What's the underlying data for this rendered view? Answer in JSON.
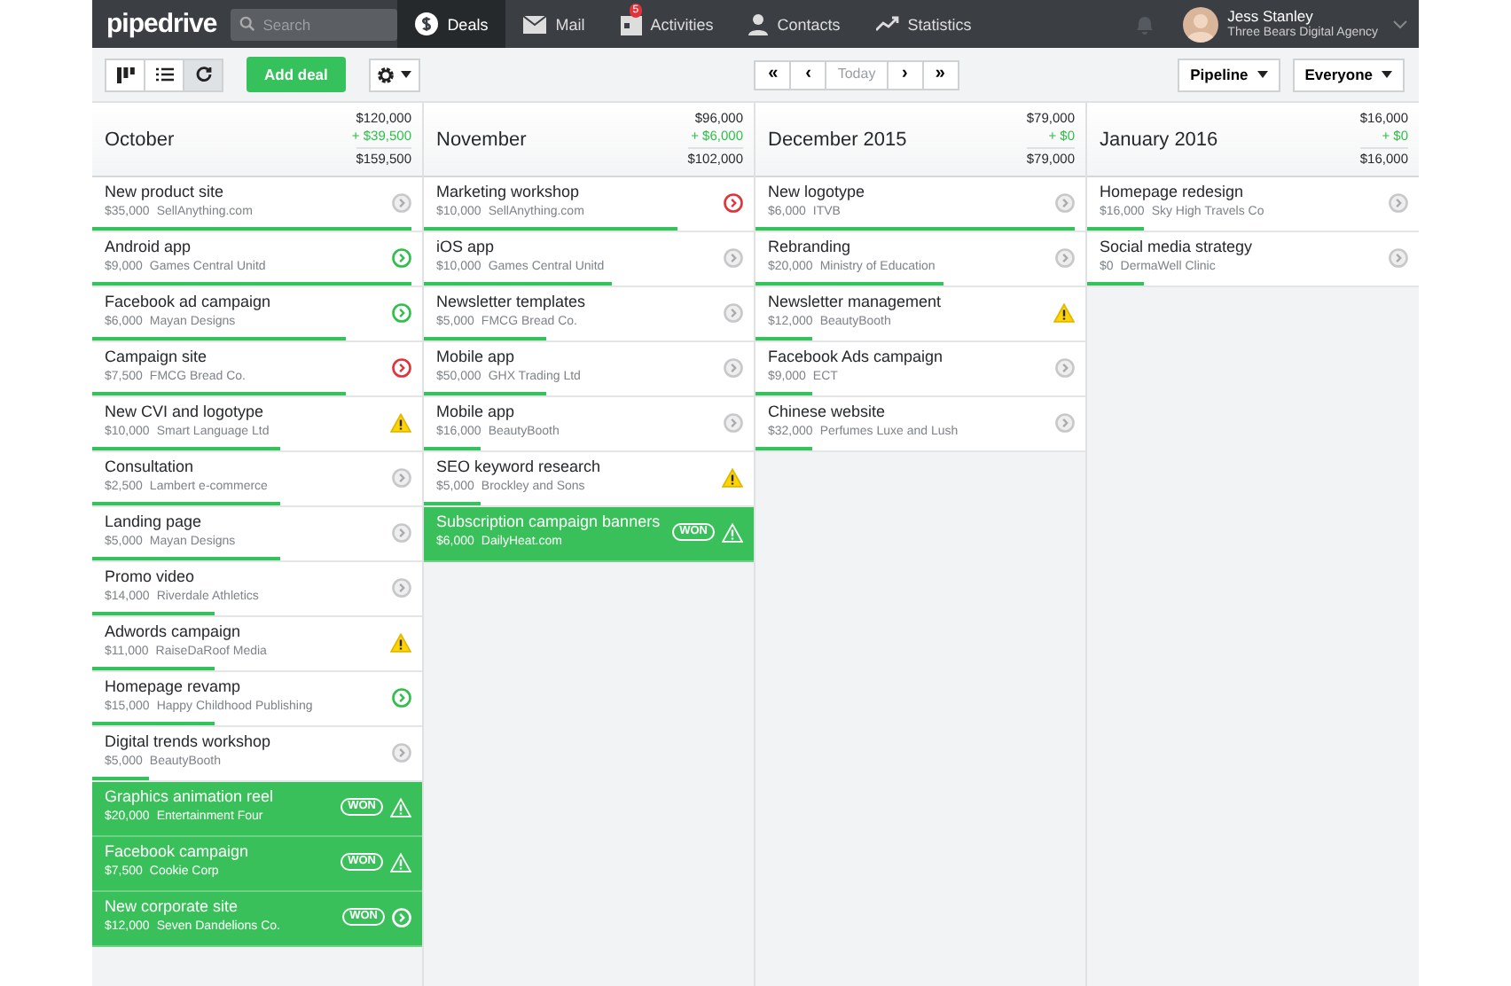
{
  "nav": {
    "logo": "pipedrive",
    "search": {
      "placeholder": "Search"
    },
    "items": [
      {
        "label": "Deals",
        "selected": true
      },
      {
        "label": "Mail",
        "selected": false
      },
      {
        "label": "Activities",
        "selected": false,
        "badge": "5"
      },
      {
        "label": "Contacts",
        "selected": false
      },
      {
        "label": "Statistics",
        "selected": false
      }
    ],
    "user": {
      "name": "Jess Stanley",
      "company": "Three Bears Digital Agency"
    }
  },
  "toolbar": {
    "views": [
      {
        "selected": false
      },
      {
        "selected": false
      },
      {
        "selected": true
      }
    ],
    "add_button": "Add deal",
    "period_nav": [
      "«",
      "‹",
      "Today",
      "›",
      "»"
    ],
    "filters": [
      "Pipeline",
      "Everyone"
    ]
  },
  "columns": [
    {
      "title": "October",
      "total": "$120,000",
      "won": "+ $39,500",
      "sum": "$159,500",
      "deals": [
        {
          "title": "New product site",
          "value": "$35,000",
          "org": "SellAnything.com",
          "kind": "none",
          "level": 0.97,
          "won": false
        },
        {
          "title": "Android app",
          "value": "$9,000",
          "org": "Games Central Unitd",
          "kind": "planned",
          "level": 0.97,
          "won": false
        },
        {
          "title": "Facebook ad campaign",
          "value": "$6,000",
          "org": "Mayan Designs",
          "kind": "planned",
          "level": 0.77,
          "won": false
        },
        {
          "title": "Campaign site",
          "value": "$7,500",
          "org": "FMCG Bread Co.",
          "kind": "overdue",
          "level": 0.77,
          "won": false
        },
        {
          "title": "New CVI and logotype",
          "value": "$10,000",
          "org": "Smart Language Ltd",
          "kind": "warning",
          "level": 0.57,
          "won": false
        },
        {
          "title": "Consultation",
          "value": "$2,500",
          "org": "Lambert e-commerce",
          "kind": "none",
          "level": 0.57,
          "won": false
        },
        {
          "title": "Landing page",
          "value": "$5,000",
          "org": "Mayan Designs",
          "kind": "none",
          "level": 0.57,
          "won": false
        },
        {
          "title": "Promo video",
          "value": "$14,000",
          "org": "Riverdale Athletics",
          "kind": "none",
          "level": 0.37,
          "won": false
        },
        {
          "title": "Adwords campaign",
          "value": "$11,000",
          "org": "RaiseDaRoof Media",
          "kind": "warning",
          "level": 0.37,
          "won": false
        },
        {
          "title": "Homepage revamp",
          "value": "$15,000",
          "org": "Happy Childhood Publishing",
          "kind": "planned",
          "level": 0.37,
          "won": false
        },
        {
          "title": "Digital trends workshop",
          "value": "$5,000",
          "org": "BeautyBooth",
          "kind": "none",
          "level": 0.17,
          "won": false
        },
        {
          "title": "Graphics animation reel",
          "value": "$20,000",
          "org": "Entertainment Four",
          "kind": "warning",
          "won": true,
          "badge": "WON"
        },
        {
          "title": "Facebook campaign",
          "value": "$7,500",
          "org": "Cookie Corp",
          "kind": "warning",
          "won": true,
          "badge": "WON"
        },
        {
          "title": "New corporate site",
          "value": "$12,000",
          "org": "Seven Dandelions Co.",
          "kind": "none",
          "won": true,
          "badge": "WON"
        }
      ]
    },
    {
      "title": "November",
      "total": "$96,000",
      "won": "+ $6,000",
      "sum": "$102,000",
      "deals": [
        {
          "title": "Marketing workshop",
          "value": "$10,000",
          "org": "SellAnything.com",
          "kind": "overdue",
          "level": 0.77,
          "won": false
        },
        {
          "title": "iOS app",
          "value": "$10,000",
          "org": "Games Central Unitd",
          "kind": "none",
          "level": 0.57,
          "won": false
        },
        {
          "title": "Newsletter templates",
          "value": "$5,000",
          "org": "FMCG Bread Co.",
          "kind": "none",
          "level": 0.37,
          "won": false
        },
        {
          "title": "Mobile app",
          "value": "$50,000",
          "org": "GHX Trading Ltd",
          "kind": "none",
          "level": 0.37,
          "won": false
        },
        {
          "title": "Mobile app",
          "value": "$16,000",
          "org": "BeautyBooth",
          "kind": "none",
          "level": 0.17,
          "won": false
        },
        {
          "title": "SEO keyword research",
          "value": "$5,000",
          "org": "Brockley and Sons",
          "kind": "warning",
          "level": 0.17,
          "won": false
        },
        {
          "title": "Subscription campaign banners",
          "value": "$6,000",
          "org": "DailyHeat.com",
          "kind": "warning",
          "won": true,
          "badge": "WON"
        }
      ]
    },
    {
      "title": "December 2015",
      "total": "$79,000",
      "won": "+ $0",
      "sum": "$79,000",
      "deals": [
        {
          "title": "New logotype",
          "value": "$6,000",
          "org": "ITVB",
          "kind": "none",
          "level": 0.97,
          "won": false
        },
        {
          "title": "Rebranding",
          "value": "$20,000",
          "org": "Ministry of Education",
          "kind": "none",
          "level": 0.57,
          "won": false
        },
        {
          "title": "Newsletter management",
          "value": "$12,000",
          "org": "BeautyBooth",
          "kind": "warning",
          "level": 0.17,
          "won": false
        },
        {
          "title": "Facebook Ads campaign",
          "value": "$9,000",
          "org": "ECT",
          "kind": "none",
          "level": 0.17,
          "won": false
        },
        {
          "title": "Chinese website",
          "value": "$32,000",
          "org": "Perfumes Luxe and Lush",
          "kind": "none",
          "level": 0.17,
          "won": false
        }
      ]
    },
    {
      "title": "January 2016",
      "total": "$16,000",
      "won": "+ $0",
      "sum": "$16,000",
      "deals": [
        {
          "title": "Homepage redesign",
          "value": "$16,000",
          "org": "Sky High Travels Co",
          "kind": "none",
          "level": 0.17,
          "won": false
        },
        {
          "title": "Social media strategy",
          "value": "$0",
          "org": "DermaWell Clinic",
          "kind": "none",
          "level": 0.17,
          "won": false
        }
      ]
    }
  ]
}
